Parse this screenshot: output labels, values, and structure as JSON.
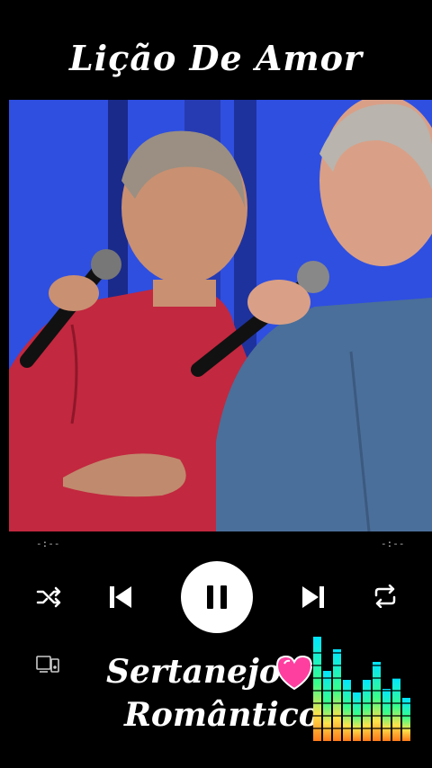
{
  "song": {
    "title": "Lição De Amor"
  },
  "player": {
    "elapsed": "-:--",
    "remaining": "-:--",
    "shuffle_icon": "shuffle-icon",
    "previous_icon": "previous-icon",
    "pause_icon": "pause-icon",
    "next_icon": "next-icon",
    "repeat_icon": "repeat-icon",
    "cast_icon": "cast-device-icon"
  },
  "brand": {
    "line1": "Sertanejo",
    "line2": "Romântico",
    "heart_icon": "heart-icon",
    "equalizer_icon": "equalizer-icon"
  },
  "colors": {
    "background": "#000000",
    "video_backdrop": "#2f4fe0",
    "pause_bg": "#ffffff",
    "heart": "#ff3fa0"
  }
}
